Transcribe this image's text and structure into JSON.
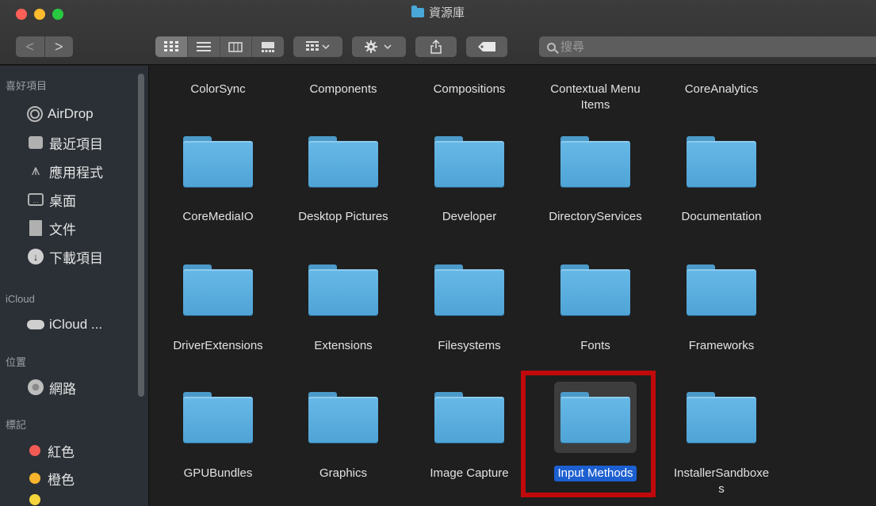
{
  "window": {
    "title": "資源庫"
  },
  "toolbar": {
    "back_label": "<",
    "forward_label": ">",
    "search_placeholder": "搜尋"
  },
  "sidebar": {
    "sections": [
      {
        "label": "喜好項目"
      },
      {
        "label": "iCloud"
      },
      {
        "label": "位置"
      },
      {
        "label": "標記"
      }
    ],
    "items": [
      {
        "label": "AirDrop",
        "icon": "airdrop-icon"
      },
      {
        "label": "最近項目",
        "icon": "recents-icon"
      },
      {
        "label": "應用程式",
        "icon": "applications-icon"
      },
      {
        "label": "桌面",
        "icon": "desktop-icon"
      },
      {
        "label": "文件",
        "icon": "documents-icon"
      },
      {
        "label": "下載項目",
        "icon": "downloads-icon"
      },
      {
        "label": "iCloud ...",
        "icon": "icloud-icon"
      },
      {
        "label": "網路",
        "icon": "network-icon"
      },
      {
        "label": "紅色",
        "color": "#f25b55"
      },
      {
        "label": "橙色",
        "color": "#f7b42c"
      }
    ]
  },
  "content": {
    "items": [
      {
        "label": "ColorSync"
      },
      {
        "label": "Components"
      },
      {
        "label": "Compositions"
      },
      {
        "label": "Contextual Menu\nItems"
      },
      {
        "label": "CoreAnalytics"
      },
      {
        "label": "CoreMediaIO"
      },
      {
        "label": "Desktop Pictures"
      },
      {
        "label": "Developer"
      },
      {
        "label": "DirectoryServices"
      },
      {
        "label": "Documentation"
      },
      {
        "label": "DriverExtensions"
      },
      {
        "label": "Extensions"
      },
      {
        "label": "Filesystems"
      },
      {
        "label": "Fonts"
      },
      {
        "label": "Frameworks"
      },
      {
        "label": "GPUBundles"
      },
      {
        "label": "Graphics"
      },
      {
        "label": "Image Capture"
      },
      {
        "label": "Input Methods",
        "selected": true
      },
      {
        "label": "InstallerSandboxe\ns"
      }
    ],
    "folder_color": "#5aaedf",
    "selection_color": "#1c5fd1",
    "highlight_color": "#c0090b"
  }
}
